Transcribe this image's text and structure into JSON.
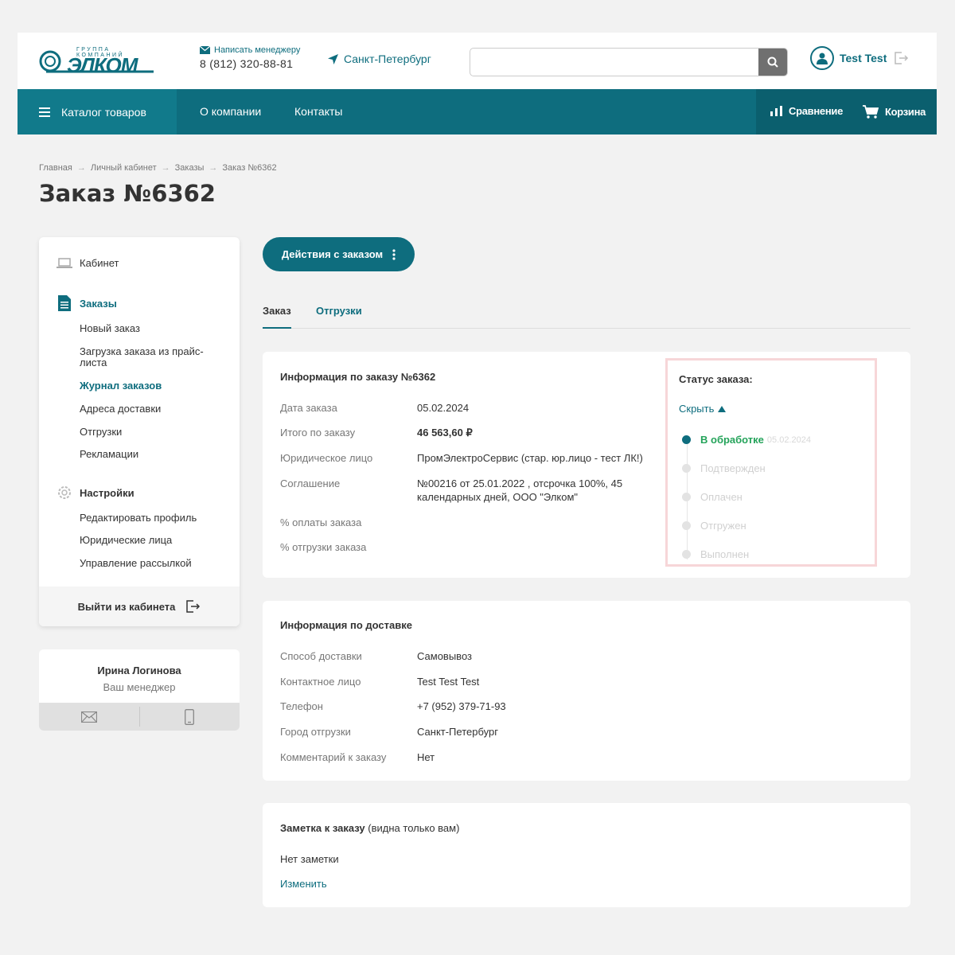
{
  "header": {
    "logo_top": "ГРУППА КОМПАНИЙ",
    "logo_main": "ЭЛКОМ",
    "contact_link": "Написать менеджеру",
    "phone": "8 (812) 320-88-81",
    "city": "Санкт-Петербург",
    "search_placeholder": "",
    "user_name": "Test Test"
  },
  "nav": {
    "catalog": "Каталог товаров",
    "about": "О компании",
    "contacts": "Контакты",
    "compare": "Сравнение",
    "cart": "Корзина"
  },
  "breadcrumb": [
    "Главная",
    "Личный кабинет",
    "Заказы",
    "Заказ №6362"
  ],
  "page_title": "Заказ №6362",
  "sidebar": {
    "cabinet": "Кабинет",
    "orders": "Заказы",
    "order_items": [
      "Новый заказ",
      "Загрузка заказа из прайс-листа",
      "Журнал заказов",
      "Адреса доставки",
      "Отгрузки",
      "Рекламации"
    ],
    "settings": "Настройки",
    "settings_items": [
      "Редактировать профиль",
      "Юридические лица",
      "Управление рассылкой"
    ],
    "logout": "Выйти из кабинета"
  },
  "manager": {
    "name": "Ирина Логинова",
    "role": "Ваш менеджер"
  },
  "actions_button": "Действия с заказом",
  "tabs": [
    "Заказ",
    "Отгрузки"
  ],
  "order_info": {
    "title": "Информация по заказу №6362",
    "rows": [
      {
        "label": "Дата заказа",
        "value": "05.02.2024"
      },
      {
        "label": "Итого по заказу",
        "value": "46 563,60 ₽"
      },
      {
        "label": "Юридическое лицо",
        "value": "ПромЭлектроСервис (стар. юр.лицо - тест ЛК!)"
      },
      {
        "label": "Соглашение",
        "value": "№00216 от 25.01.2022 , отсрочка 100%, 45 календарных дней, ООО \"Элком\""
      },
      {
        "label": "% оплаты заказа",
        "value": ""
      },
      {
        "label": "% отгрузки заказа",
        "value": ""
      }
    ]
  },
  "status": {
    "title": "Статус заказа:",
    "toggle": "Скрыть",
    "steps": [
      {
        "label": "В обработке",
        "date": "05.02.2024"
      },
      {
        "label": "Подтвержден",
        "date": ""
      },
      {
        "label": "Оплачен",
        "date": ""
      },
      {
        "label": "Отгружен",
        "date": ""
      },
      {
        "label": "Выполнен",
        "date": ""
      }
    ]
  },
  "delivery": {
    "title": "Информация по доставке",
    "rows": [
      {
        "label": "Способ доставки",
        "value": "Самовывоз"
      },
      {
        "label": "Контактное лицо",
        "value": "Test Test Test"
      },
      {
        "label": "Телефон",
        "value": "+7 (952) 379-71-93"
      },
      {
        "label": "Город отгрузки",
        "value": "Санкт-Петербург"
      },
      {
        "label": "Комментарий к заказу",
        "value": "Нет"
      }
    ]
  },
  "note": {
    "title_bold": "Заметка к заказу",
    "title_rest": " (видна только вам)",
    "text": "Нет заметки",
    "edit": "Изменить"
  },
  "colors": {
    "brand": "#0e6d7e",
    "status_active": "#24a35a",
    "highlight_border": "#f7d6d8"
  }
}
